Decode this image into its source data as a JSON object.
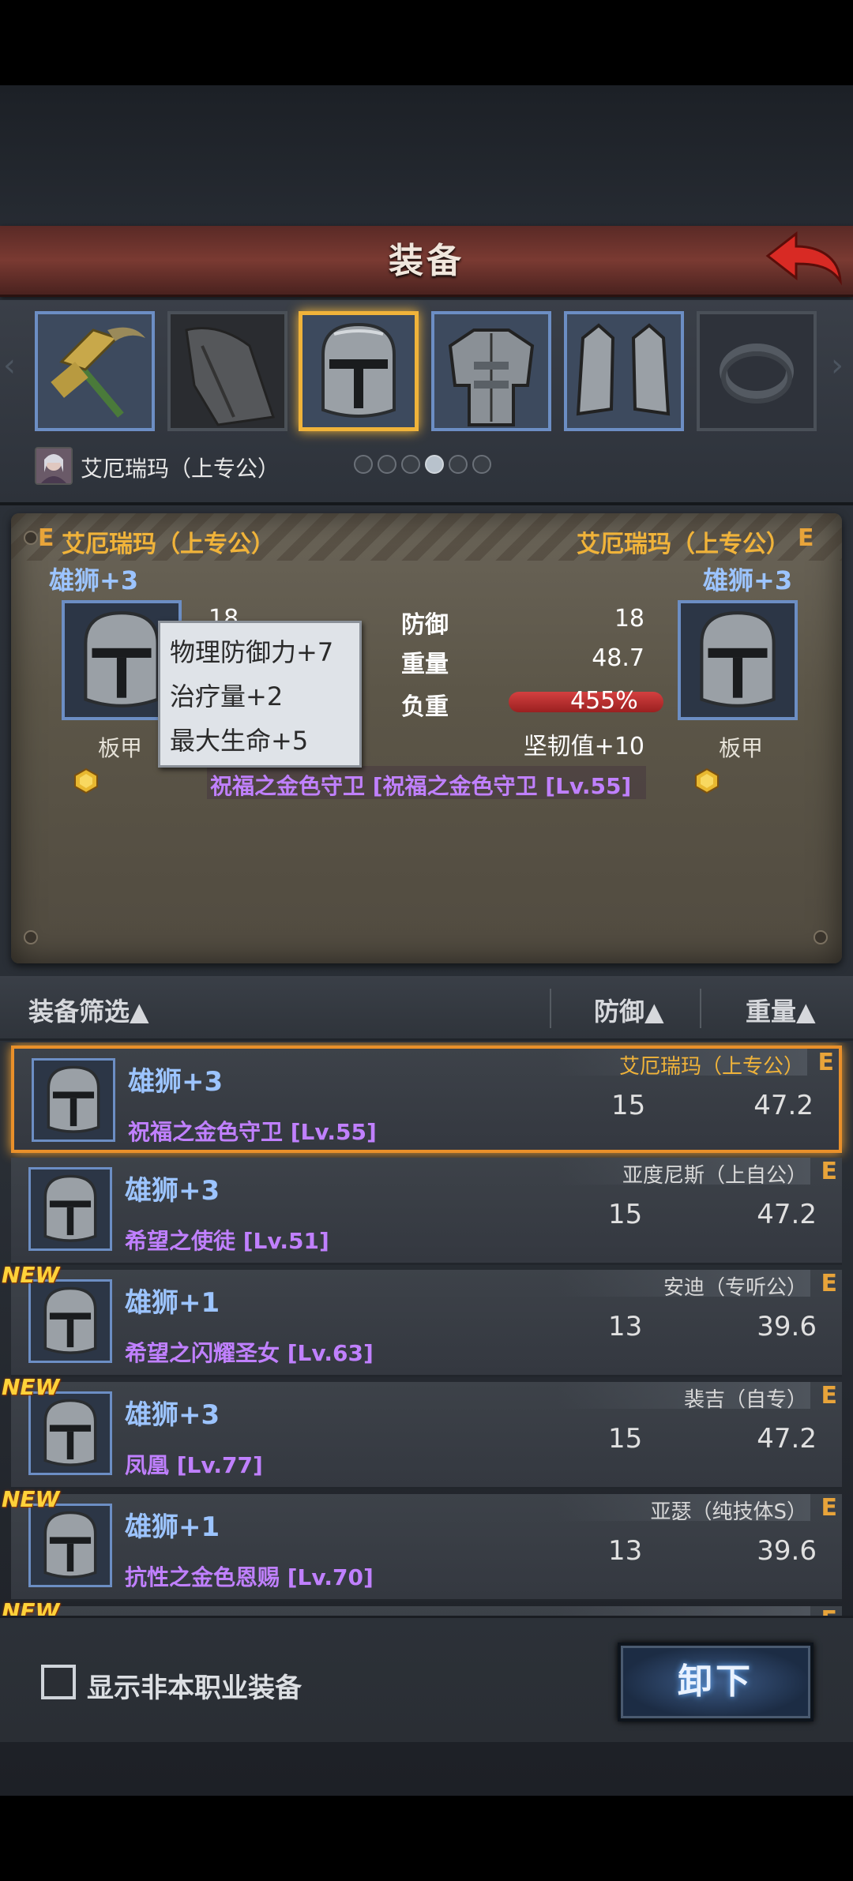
{
  "header": {
    "title": "装备"
  },
  "character": {
    "name": "艾厄瑞玛（上专公）",
    "page_count": 6,
    "page_active": 3
  },
  "compare": {
    "left": {
      "rank": "E",
      "owner": "艾厄瑞玛（上专公）",
      "name": "雄狮+3",
      "type": "板甲",
      "def_partial": "18"
    },
    "right": {
      "rank": "E",
      "owner": "艾厄瑞玛（上专公）",
      "name": "雄狮+3",
      "type": "板甲"
    },
    "stats": [
      {
        "label": "防御",
        "value": "18"
      },
      {
        "label": "重量",
        "value": "48.7"
      },
      {
        "label": "负重",
        "value": "455%"
      },
      {
        "label": "",
        "value": "坚韧值+10"
      }
    ],
    "set_text": "祝福之金色守卫 [祝福之金色守卫 [Lv.55]",
    "tooltip": [
      "物理防御力+7",
      "治疗量+2",
      "最大生命+5"
    ]
  },
  "list_header": {
    "filter": "装备筛选▲",
    "def": "防御▲",
    "weight": "重量▲"
  },
  "items": [
    {
      "name": "雄狮+3",
      "set": "祝福之金色守卫 [Lv.55]",
      "owner": "艾厄瑞玛（上专公）",
      "rank": "E",
      "def": "15",
      "weight": "47.2",
      "new": "",
      "selected": true
    },
    {
      "name": "雄狮+3",
      "set": "希望之使徒 [Lv.51]",
      "owner": "亚度尼斯（上自公）",
      "rank": "E",
      "def": "15",
      "weight": "47.2",
      "new": "",
      "selected": false
    },
    {
      "name": "雄狮+1",
      "set": "希望之闪耀圣女 [Lv.63]",
      "owner": "安迪（专听公）",
      "rank": "E",
      "def": "13",
      "weight": "39.6",
      "new": "NEW",
      "selected": false
    },
    {
      "name": "雄狮+3",
      "set": "凤凰 [Lv.77]",
      "owner": "裴吉（自专）",
      "rank": "E",
      "def": "15",
      "weight": "47.2",
      "new": "NEW",
      "selected": false
    },
    {
      "name": "雄狮+1",
      "set": "抗性之金色恩赐 [Lv.70]",
      "owner": "亚瑟（纯技体S）",
      "rank": "E",
      "def": "13",
      "weight": "39.6",
      "new": "NEW",
      "selected": false
    },
    {
      "name": "",
      "set": "",
      "owner": "",
      "rank": "E",
      "def": "",
      "weight": "",
      "new": "NEW",
      "selected": false
    }
  ],
  "footer": {
    "show_other_class": "显示非本职业装备",
    "checked": false,
    "unequip": "卸下"
  },
  "colors": {
    "accent_gold": "#f0b33a",
    "item_blue": "#9cc4ff",
    "set_purple": "#c080ff",
    "title_red": "#7a3a32"
  }
}
